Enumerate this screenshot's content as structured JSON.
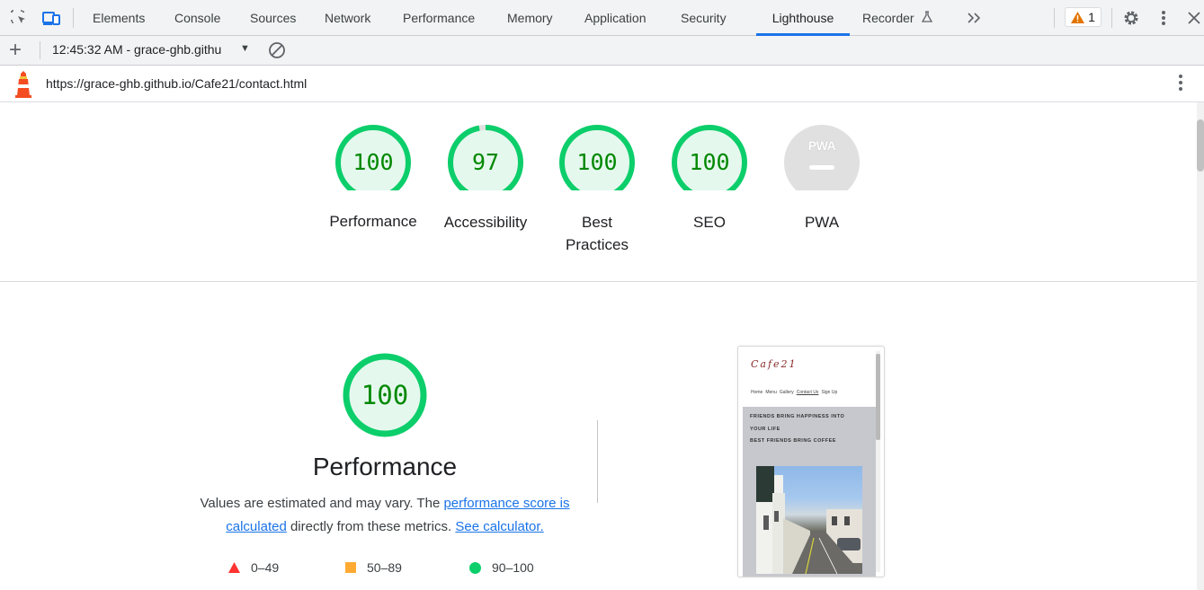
{
  "devtools": {
    "tabs": [
      {
        "label": "Elements"
      },
      {
        "label": "Console"
      },
      {
        "label": "Sources"
      },
      {
        "label": "Network"
      },
      {
        "label": "Performance"
      },
      {
        "label": "Memory"
      },
      {
        "label": "Application"
      },
      {
        "label": "Security"
      },
      {
        "label": "Lighthouse"
      },
      {
        "label": "Recorder"
      }
    ],
    "active_tab": "Lighthouse",
    "warning_count": "1",
    "accent_color": "#1a73e8"
  },
  "toolbar": {
    "session": "12:45:32 AM - grace-ghb.githu"
  },
  "urlbar": {
    "url": "https://grace-ghb.github.io/Cafe21/contact.html"
  },
  "scores": [
    {
      "label": "Performance",
      "value": "100",
      "fraction": 1.0
    },
    {
      "label": "Accessibility",
      "value": "97",
      "fraction": 0.97
    },
    {
      "label": "Best Practices",
      "value": "100",
      "fraction": 1.0
    },
    {
      "label": "SEO",
      "value": "100",
      "fraction": 1.0
    },
    {
      "label": "PWA",
      "value": "",
      "badge": "PWA"
    }
  ],
  "performance": {
    "score": "100",
    "title": "Performance",
    "desc_prefix": "Values are estimated and may vary. The ",
    "link1": "performance score is calculated",
    "desc_mid": " directly from these metrics. ",
    "link2": "See calculator."
  },
  "legend": [
    {
      "range": "0–49",
      "color": "#ff3333"
    },
    {
      "range": "50–89",
      "color": "#ffaa33"
    },
    {
      "range": "90–100",
      "color": "#0cce6b"
    }
  ],
  "preview": {
    "logo": "Cafe21",
    "nav": [
      "Home",
      "Menu",
      "Gallery",
      "Contact Us",
      "Sign Up"
    ],
    "lines": [
      "FRIENDS BRING HAPPINESS INTO",
      "YOUR LIFE",
      "BEST FRIENDS BRING COFFEE"
    ]
  },
  "colors": {
    "pass": "#0cce6b",
    "pass_fill": "#e5f8ee",
    "pass_text": "#008800",
    "pwa_gray": "#e0e0e0"
  }
}
